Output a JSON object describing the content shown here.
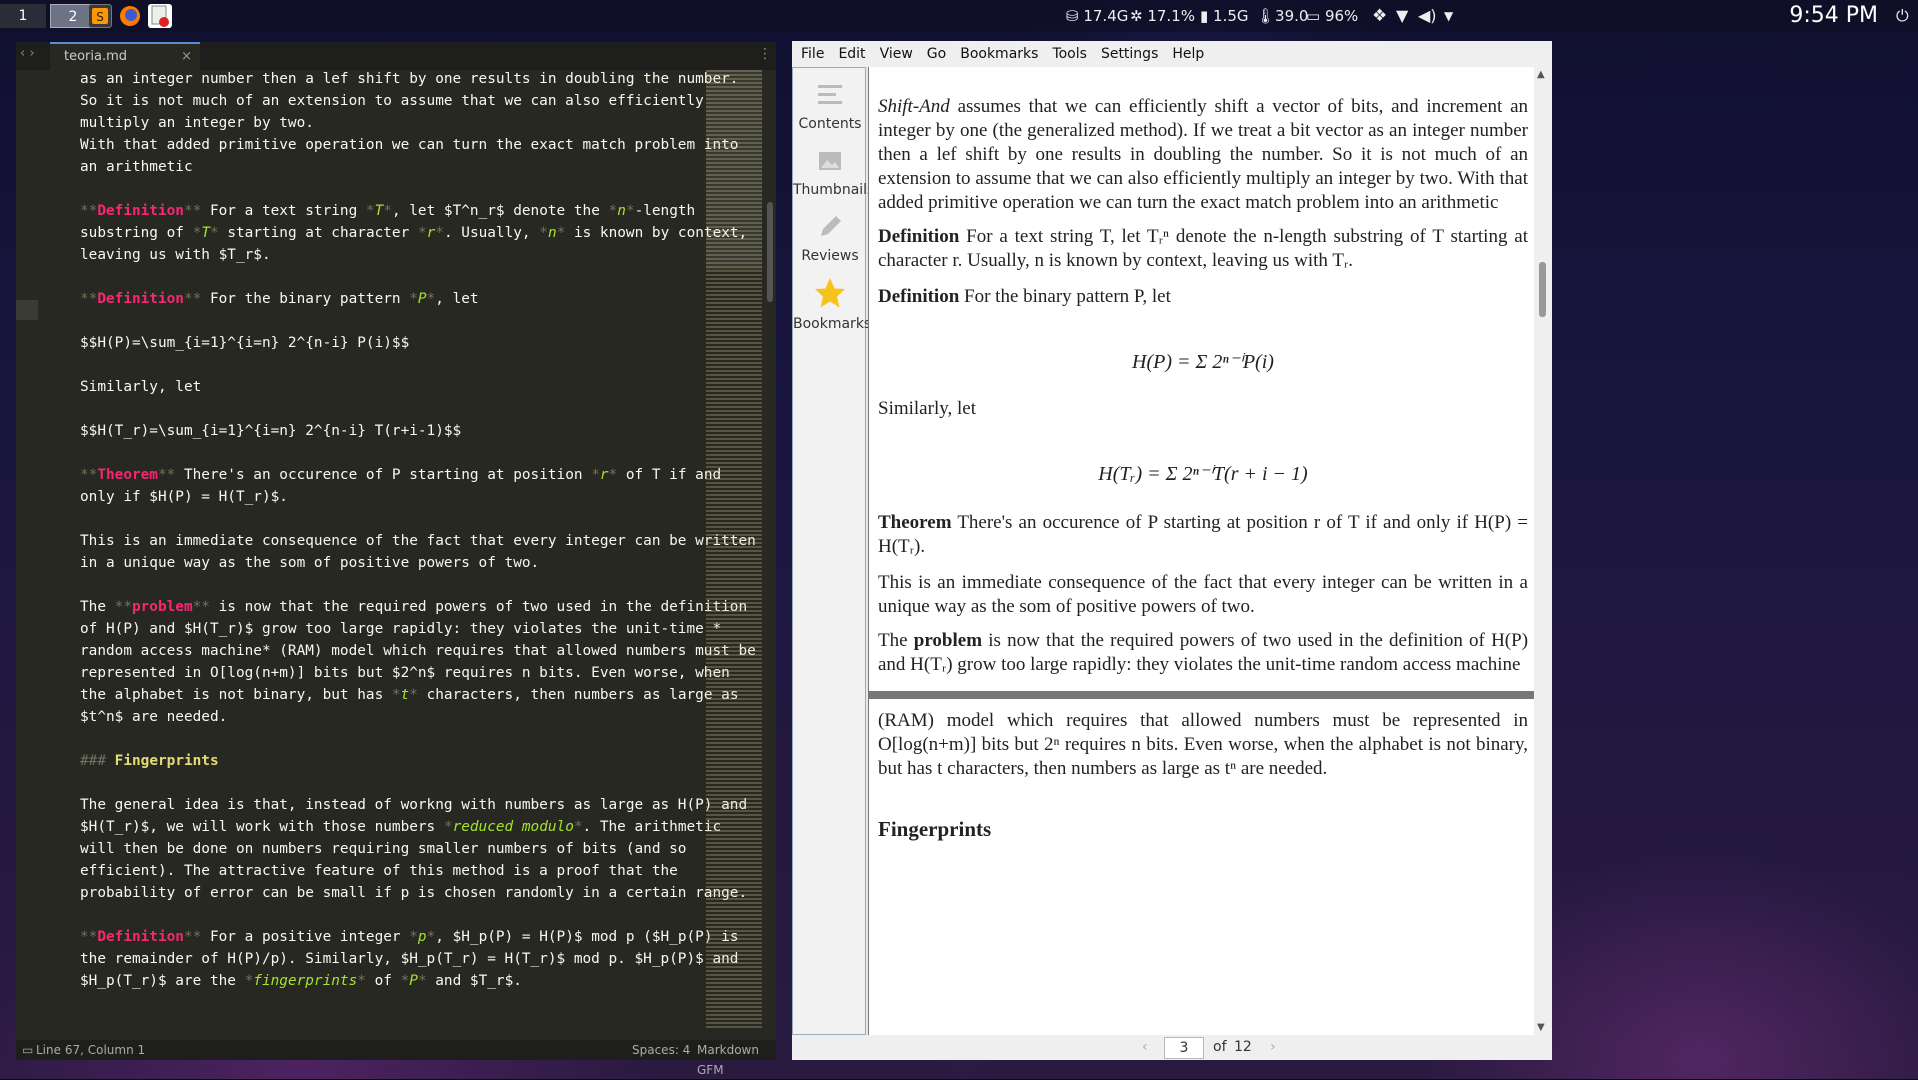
{
  "taskbar": {
    "workspaces": [
      "1",
      "2"
    ],
    "tray": {
      "disk": "17.4G",
      "cpu": "17.1%",
      "mem": "1.5G",
      "temp": "39.0",
      "battery": "96%"
    },
    "clock": "9:54 PM"
  },
  "editor": {
    "tab_label": "teoria.md",
    "status_left": "Line 67, Column 1",
    "status_spaces": "Spaces: 4",
    "status_syntax": "Markdown GFM",
    "lines": [
      "as an integer number then a lef shift by one results in doubling the number.",
      "So it is not much of an extension to assume that we can also efficiently",
      "multiply an integer by two.",
      "With that added primitive operation we can turn the exact match problem into",
      "an arithmetic",
      "",
      "**Definition** For a text string *T*, let $T^n_r$ denote the *n*-length",
      "substring of *T* starting at character *r*. Usually, *n* is known by context,",
      "leaving us with $T_r$.",
      "",
      "**Definition** For the binary pattern *P*, let",
      "",
      "$$H(P)=\\sum_{i=1}^{i=n} 2^{n-i} P(i)$$",
      "",
      "Similarly, let",
      "",
      "$$H(T_r)=\\sum_{i=1}^{i=n} 2^{n-i} T(r+i-1)$$",
      "",
      "**Theorem** There's an occurence of P starting at position *r* of T if and",
      "only if $H(P) = H(T_r)$.",
      "",
      "This is an immediate consequence of the fact that every integer can be written",
      "in a unique way as the som of positive powers of two.",
      "",
      "The **problem** is now that the required powers of two used in the definition",
      "of H(P) and $H(T_r)$ grow too large rapidly: they violates the unit-time *",
      "random access machine* (RAM) model which requires that allowed numbers must be",
      "represented in O[log(n+m)] bits but $2^n$ requires n bits. Even worse, when",
      "the alphabet is not binary, but has *t* characters, then numbers as large as",
      "$t^n$ are needed.",
      "",
      "### Fingerprints",
      "",
      "The general idea is that, instead of workng with numbers as large as H(P) and",
      "$H(T_r)$, we will work with those numbers *reduced modulo*. The arithmetic",
      "will then be done on numbers requiring smaller numbers of bits (and so",
      "efficient). The attractive feature of this method is a proof that the",
      "probability of error can be small if p is chosen randomly in a certain range.",
      "",
      "**Definition** For a positive integer *p*, $H_p(P) = H(P)$ mod p ($H_p(P) is",
      "the remainder of H(P)/p). Similarly, $H_p(T_r) = H(T_r)$ mod p. $H_p(P)$ and",
      "$H_p(T_r)$ are the *fingerprints* of *P* and $T_r$."
    ]
  },
  "viewer": {
    "menu": [
      "File",
      "Edit",
      "View",
      "Go",
      "Bookmarks",
      "Tools",
      "Settings",
      "Help"
    ],
    "sidebar": [
      "Contents",
      "Thumbnails",
      "Reviews",
      "Bookmarks"
    ],
    "page_number": "3",
    "page_of": "of",
    "page_total": "12",
    "doc": {
      "p1": "Shift-And assumes that we can efficiently shift a vector of bits, and increment an integer by one (the generalized method). If we treat a bit vector as an integer number then a lef shift by one results in doubling the number. So it is not much of an extension to assume that we can also efficiently multiply an integer by two. With that added primitive operation we can turn the exact match problem into an arithmetic",
      "def1_label": "Definition",
      "def1": "For a text string T, let Tᵣⁿ denote the n-length substring of T starting at character r. Usually, n is known by context, leaving us with Tᵣ.",
      "def2_label": "Definition",
      "def2": "For the binary pattern P, let",
      "eq1": "H(P) = Σ 2ⁿ⁻ⁱP(i)",
      "similarly": "Similarly, let",
      "eq2": "H(Tᵣ) = Σ 2ⁿ⁻ⁱT(r + i − 1)",
      "thm_label": "Theorem",
      "thm": "There's an occurence of P starting at position r of T if and only if H(P) = H(Tᵣ).",
      "p2": "This is an immediate consequence of the fact that every integer can be written in a unique way as the som of positive powers of two.",
      "p3a": "The",
      "p3_bold": "problem",
      "p3b": "is now that the required powers of two used in the definition of H(P) and H(Tᵣ) grow too large rapidly: they violates the unit-time random access machine",
      "p4": "(RAM) model which requires that allowed numbers must be represented in O[log(n+m)] bits but 2ⁿ requires n bits. Even worse, when the alphabet is not binary, but has t characters, then numbers as large as tⁿ are needed.",
      "heading": "Fingerprints"
    }
  }
}
